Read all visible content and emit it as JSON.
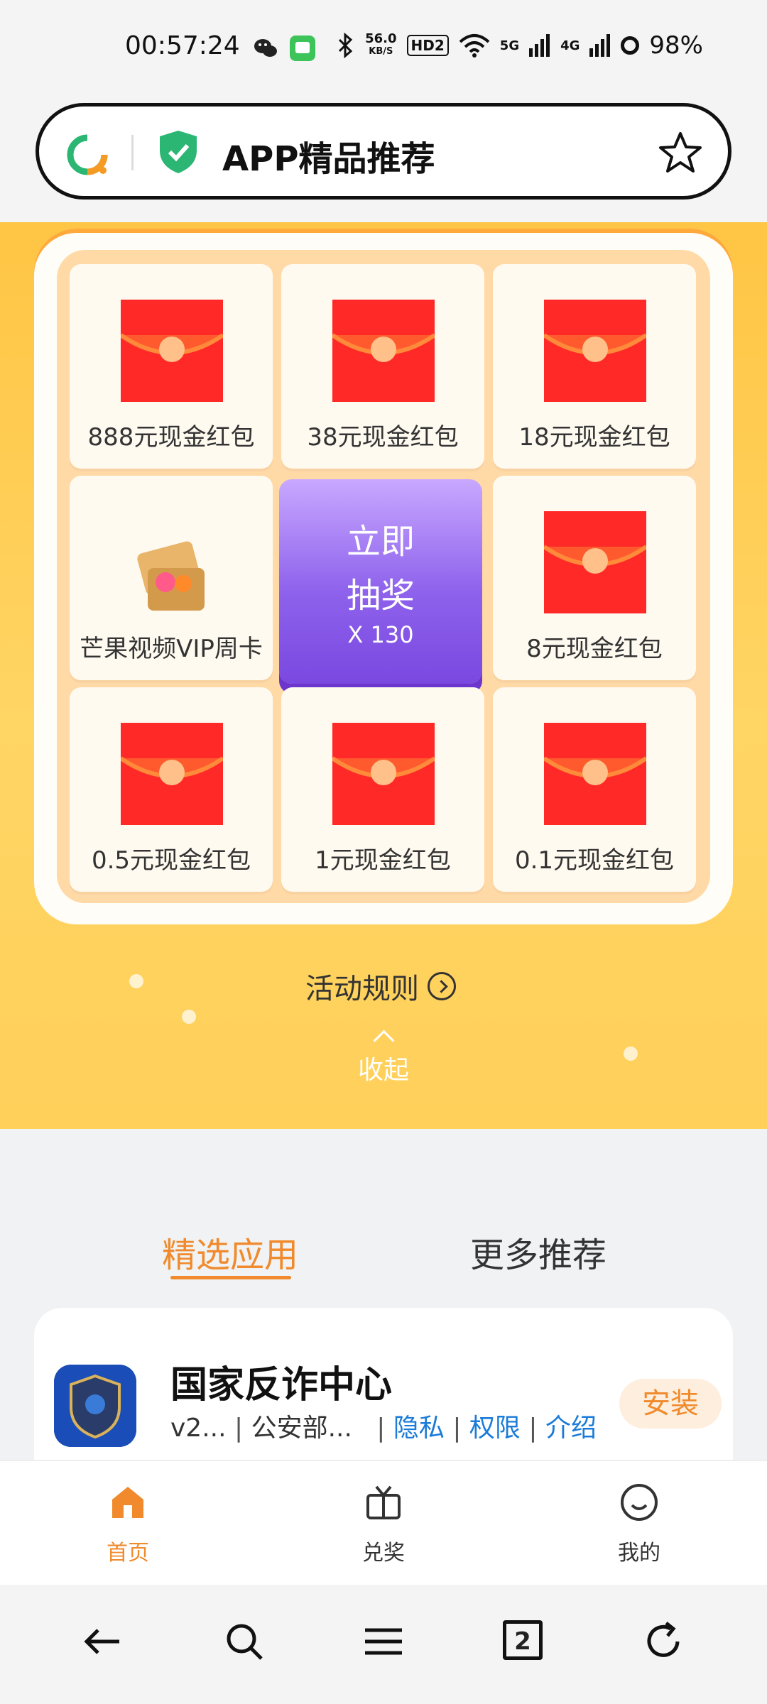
{
  "status_bar": {
    "time": "00:57:24",
    "net_speed": "56.0",
    "net_unit": "KB/S",
    "hd": "HD2",
    "signal1": "5G",
    "signal2": "4G",
    "battery": "98%"
  },
  "url_bar": {
    "title": "APP精品推荐"
  },
  "lottery": {
    "prizes": [
      "888元现金红包",
      "38元现金红包",
      "18元现金红包",
      "芒果视频VIP周卡",
      "8元现金红包",
      "0.5元现金红包",
      "1元现金红包",
      "0.1元现金红包"
    ],
    "draw_button": {
      "line1": "立即",
      "line2": "抽奖",
      "count": "X 130"
    },
    "rules": "活动规则",
    "collapse": "收起"
  },
  "tabs": [
    {
      "label": "精选应用",
      "active": true
    },
    {
      "label": "更多推荐",
      "active": false
    }
  ],
  "app": {
    "name": "国家反诈中心",
    "version": "v2...",
    "developer": "公安部...",
    "privacy": "隐私",
    "permissions": "权限",
    "intro": "介绍",
    "install": "安装"
  },
  "bottom_nav": [
    {
      "label": "首页",
      "active": true
    },
    {
      "label": "兑奖",
      "active": false
    },
    {
      "label": "我的",
      "active": false
    }
  ],
  "system_bar": {
    "tab_count": "2"
  },
  "colors": {
    "accent": "#f08a2c",
    "link": "#1b7bd8",
    "draw_button": "#8e62ec",
    "background_yellow": "#ffc544"
  }
}
